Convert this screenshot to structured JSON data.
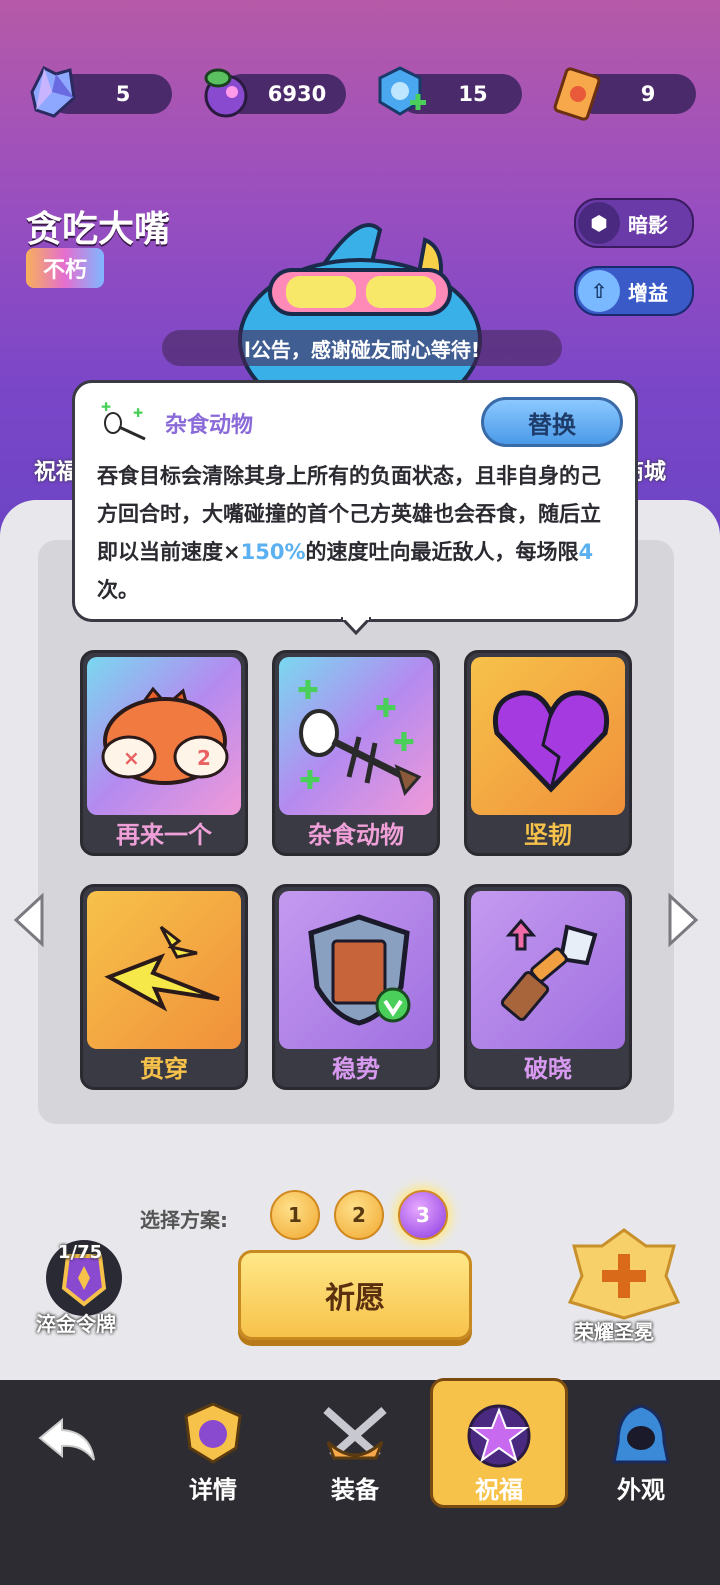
{
  "resources": [
    {
      "icon": "crystal-icon",
      "value": "5"
    },
    {
      "icon": "potion-icon",
      "value": "6930"
    },
    {
      "icon": "hex-gem-plus-icon",
      "value": "15"
    },
    {
      "icon": "ticket-icon",
      "value": "9"
    }
  ],
  "hero": {
    "name": "贪吃大嘴",
    "rank": "不朽"
  },
  "side_buttons": {
    "shadow": "暗影",
    "buff": "增益"
  },
  "notice": "l公告，感谢碰友耐心等待!",
  "partial_labels": {
    "left": "祝福",
    "right": "商城"
  },
  "tooltip": {
    "title": "杂食动物",
    "swap": "替换",
    "text_a": "吞食目标会清除其身上所有的负面状态，且非自身的己方回合时，大嘴碰撞的首个己方英雄也会吞食，随后立即以当前速度×",
    "text_hl1": "150%",
    "text_b": "的速度吐向最近敌人，每场限",
    "text_hl2": "4",
    "text_c": "次。"
  },
  "cards": [
    {
      "label": "再来一个",
      "tier": "rainbow"
    },
    {
      "label": "杂食动物",
      "tier": "rainbow"
    },
    {
      "label": "坚韧",
      "tier": "gold"
    },
    {
      "label": "贯穿",
      "tier": "gold"
    },
    {
      "label": "稳势",
      "tier": "purple"
    },
    {
      "label": "破晓",
      "tier": "purple"
    }
  ],
  "plan": {
    "label": "选择方案:",
    "options": [
      "1",
      "2",
      "3"
    ],
    "selected": "3"
  },
  "medal": {
    "progress": "1/75",
    "label": "淬金令牌"
  },
  "pray_button": "祈愿",
  "shrine": {
    "label": "荣耀圣冕"
  },
  "nav": [
    {
      "label": "详情"
    },
    {
      "label": "装备"
    },
    {
      "label": "祝福"
    },
    {
      "label": "外观"
    }
  ],
  "colors": {
    "accent_gold": "#f7c24a",
    "highlight_blue": "#5ab0f0",
    "purple_bg": "#7a46c8"
  }
}
